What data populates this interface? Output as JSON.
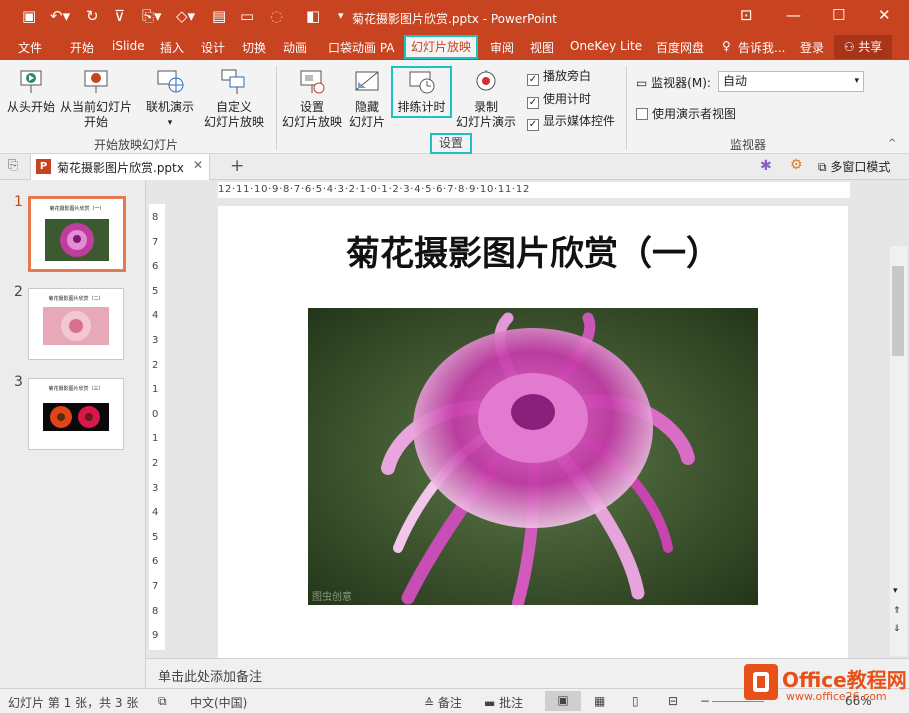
{
  "app": {
    "window_title": "菊花摄影图片欣赏.pptx - PowerPoint"
  },
  "menu": {
    "tabs": [
      "文件",
      "开始",
      "iSlide",
      "插入",
      "设计",
      "切换",
      "动画",
      "口袋动画 PA",
      "幻灯片放映",
      "审阅",
      "视图",
      "OneKey Lite",
      "百度网盘"
    ],
    "active_tab": "幻灯片放映",
    "tell_me": "告诉我...",
    "login": "登录",
    "share": "共享"
  },
  "ribbon": {
    "start_group": {
      "from_beginning": "从头开始",
      "from_current_1": "从当前幻灯片",
      "from_current_2": "开始",
      "online_1": "联机演示",
      "custom_1": "自定义",
      "custom_2": "幻灯片放映",
      "label": "开始放映幻灯片"
    },
    "setup_group": {
      "setup_1": "设置",
      "setup_2": "幻灯片放映",
      "hide_1": "隐藏",
      "hide_2": "幻灯片",
      "rehearse": "排练计时",
      "record_1": "录制",
      "record_2": "幻灯片演示",
      "label": "设置"
    },
    "checks": [
      {
        "label": "播放旁白",
        "checked": true
      },
      {
        "label": "使用计时",
        "checked": true
      },
      {
        "label": "显示媒体控件",
        "checked": true
      }
    ],
    "monitor_group": {
      "monitor_label": "监视器(M):",
      "monitor_value": "自动",
      "presenter_view": "使用演示者视图",
      "presenter_checked": false,
      "label": "监视器"
    }
  },
  "doc_tabs": {
    "file_tab": "菊花摄影图片欣赏.pptx",
    "multi_window": "多窗口模式"
  },
  "ruler": {
    "h_ticks": "12·11·10·9·8·7·6·5·4·3·2·1·0·1·2·3·4·5·6·7·8·9·10·11·12",
    "v_ticks": [
      "8",
      "7",
      "6",
      "5",
      "4",
      "3",
      "2",
      "1",
      "0",
      "1",
      "2",
      "3",
      "4",
      "5",
      "6",
      "7",
      "8",
      "9"
    ]
  },
  "thumbnails": [
    {
      "num": "1",
      "title": "菊花摄影图片欣赏（一）",
      "selected": true
    },
    {
      "num": "2",
      "title": "菊花摄影图片欣赏（二）",
      "selected": false
    },
    {
      "num": "3",
      "title": "菊花摄影图片欣赏（三）",
      "selected": false
    }
  ],
  "slide": {
    "title": "菊花摄影图片欣赏（一）",
    "watermark": "图虫创意"
  },
  "notes": {
    "placeholder": "单击此处添加备注"
  },
  "status": {
    "slide_info": "幻灯片 第 1 张，共 3 张",
    "language": "中文(中国)",
    "notes": "备注",
    "comments": "批注",
    "zoom": "66%"
  },
  "brand": {
    "logo": "Office教程网",
    "url": "www.office26.com"
  },
  "colors": {
    "accent": "#c84320",
    "highlight": "#18c4c0"
  }
}
